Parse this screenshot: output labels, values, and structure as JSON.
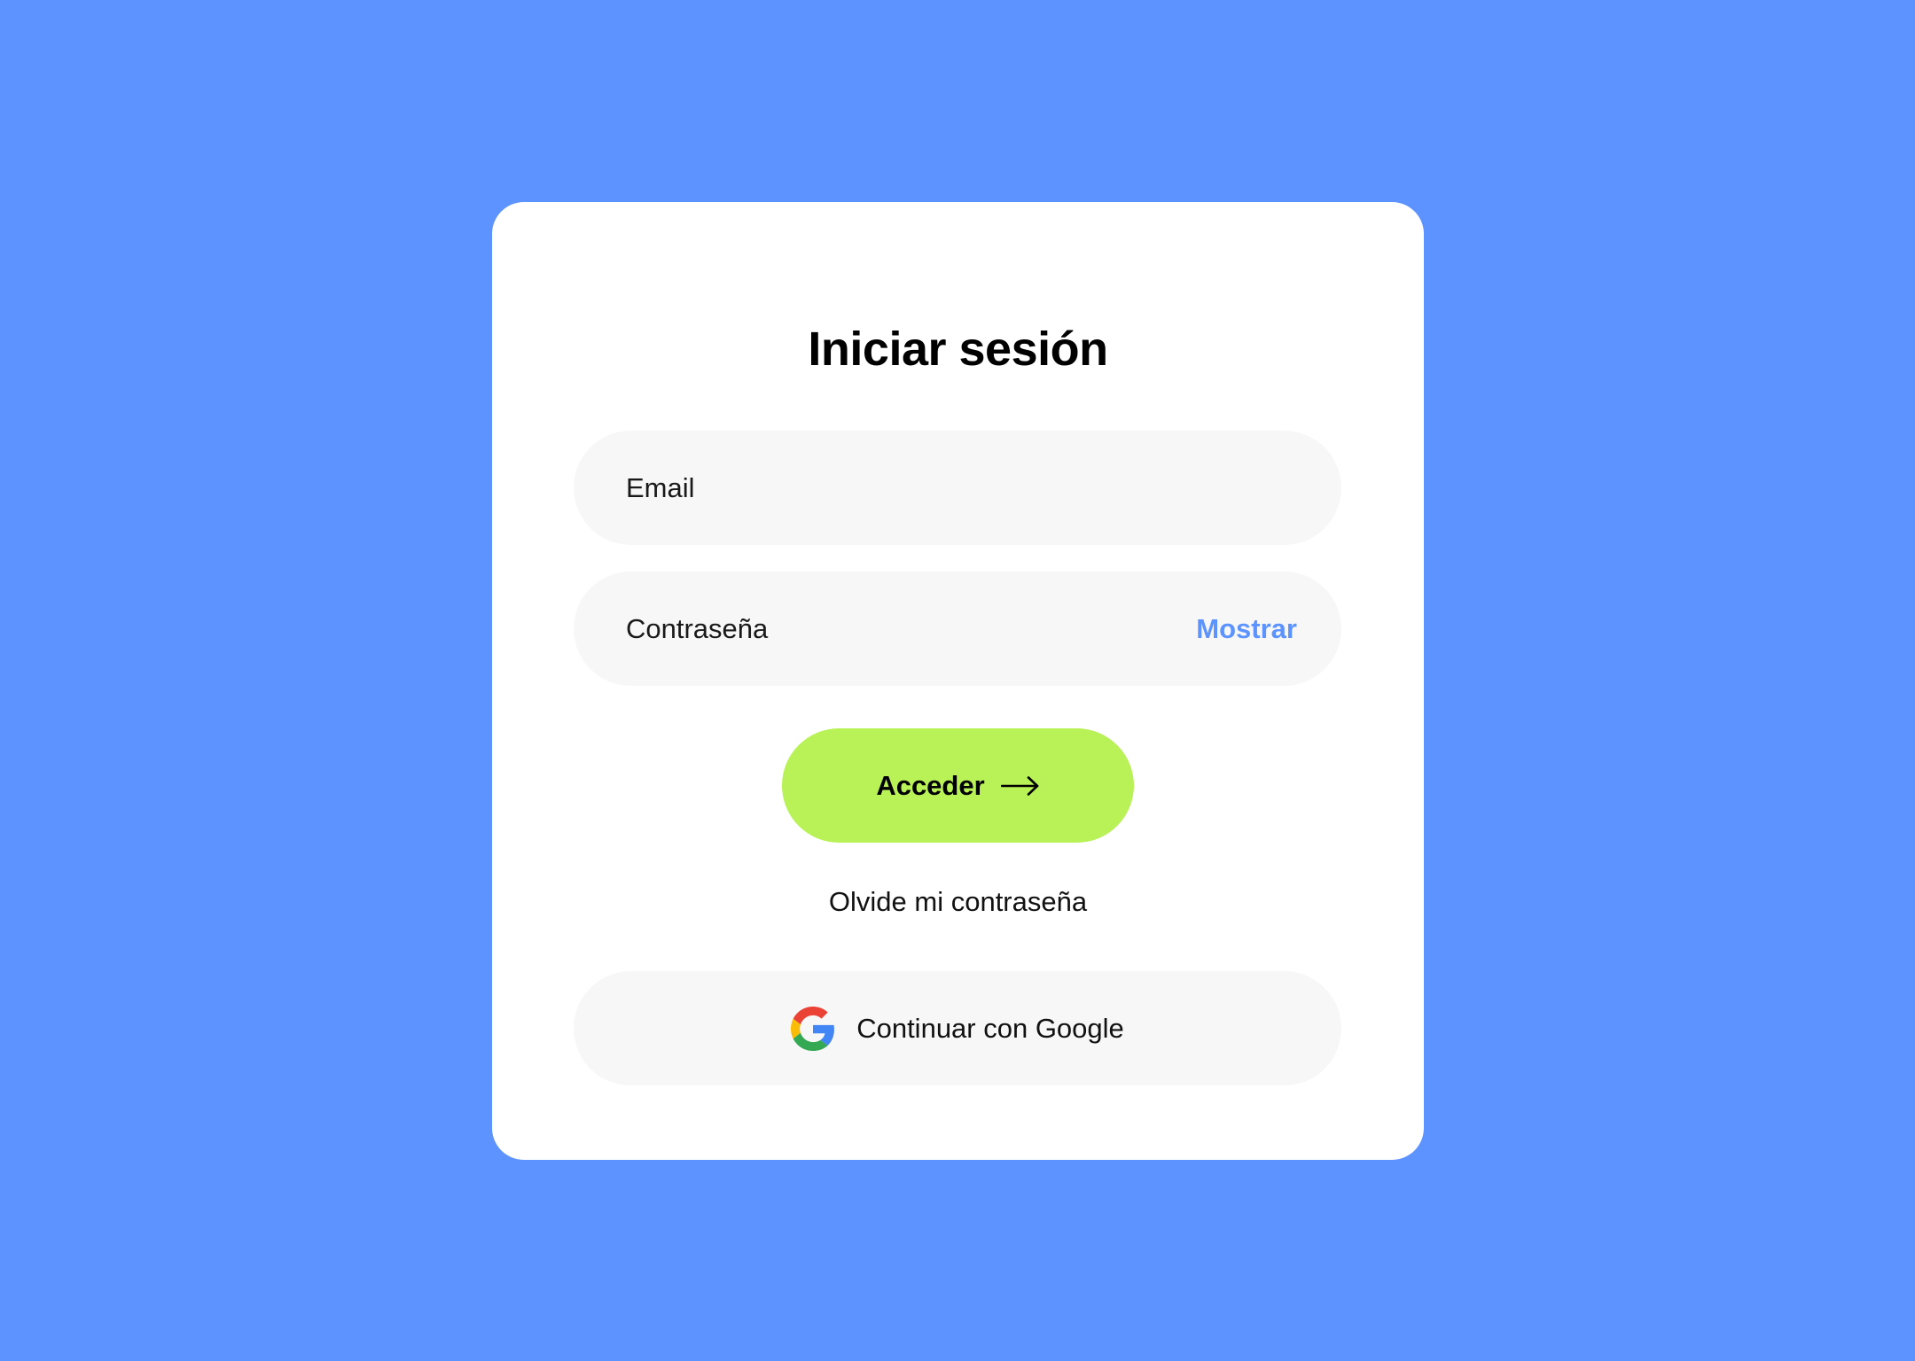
{
  "login": {
    "title": "Iniciar sesión",
    "email": {
      "placeholder": "Email",
      "value": ""
    },
    "password": {
      "placeholder": "Contraseña",
      "value": "",
      "show_label": "Mostrar"
    },
    "submit_label": "Acceder",
    "submit_icon": "arrow-right-icon",
    "forgot_label": "Olvide mi contraseña",
    "google": {
      "label": "Continuar con Google",
      "icon": "google-icon"
    }
  },
  "colors": {
    "background": "#5c93ff",
    "card": "#ffffff",
    "field": "#f7f7f7",
    "accent": "#5c93ff",
    "submit": "#b8f256",
    "text": "#000000"
  }
}
